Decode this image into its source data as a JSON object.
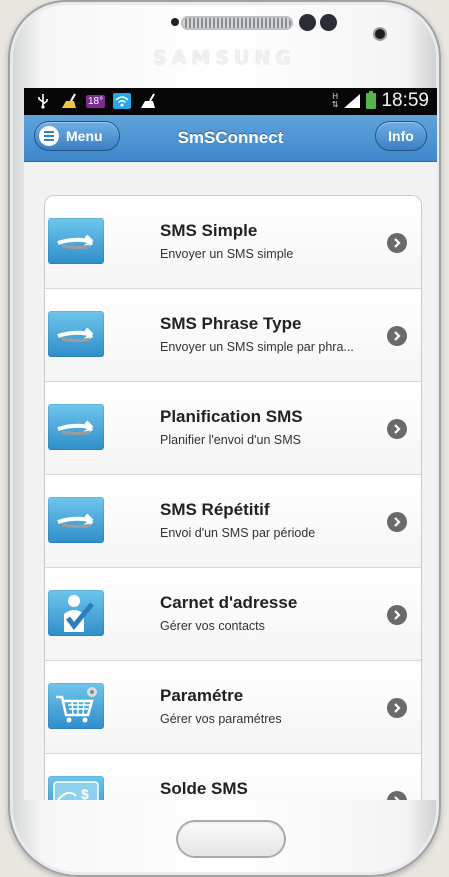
{
  "device": {
    "brand": "SAMSUNG"
  },
  "statusbar": {
    "badge": "18°",
    "network": "H",
    "time": "18:59",
    "icons": [
      "usb-icon",
      "cleaner-icon",
      "notification-badge",
      "wifi-icon",
      "cleaner-icon-2",
      "signal-icon",
      "battery-charging-icon"
    ]
  },
  "appbar": {
    "title": "SmSConnect",
    "menu_label": "Menu",
    "info_label": "Info",
    "accent": "#3f88cc"
  },
  "items": [
    {
      "title": "SMS Simple",
      "subtitle": "Envoyer un SMS simple",
      "icon": "sms-arrow-icon"
    },
    {
      "title": "SMS Phrase Type",
      "subtitle": "Envoyer un SMS simple par phra...",
      "icon": "sms-arrow-icon"
    },
    {
      "title": "Planification SMS",
      "subtitle": "Planifier l'envoi d'un SMS",
      "icon": "sms-arrow-icon"
    },
    {
      "title": "SMS Répétitif",
      "subtitle": "Envoi d'un SMS par période",
      "icon": "sms-arrow-icon"
    },
    {
      "title": "Carnet d'adresse",
      "subtitle": "Gérer vos contacts",
      "icon": "contact-icon"
    },
    {
      "title": "Paramétre",
      "subtitle": "Gérer vos paramétres",
      "icon": "cart-settings-icon"
    },
    {
      "title": "Solde SMS",
      "subtitle": "",
      "icon": "money-icon"
    }
  ]
}
